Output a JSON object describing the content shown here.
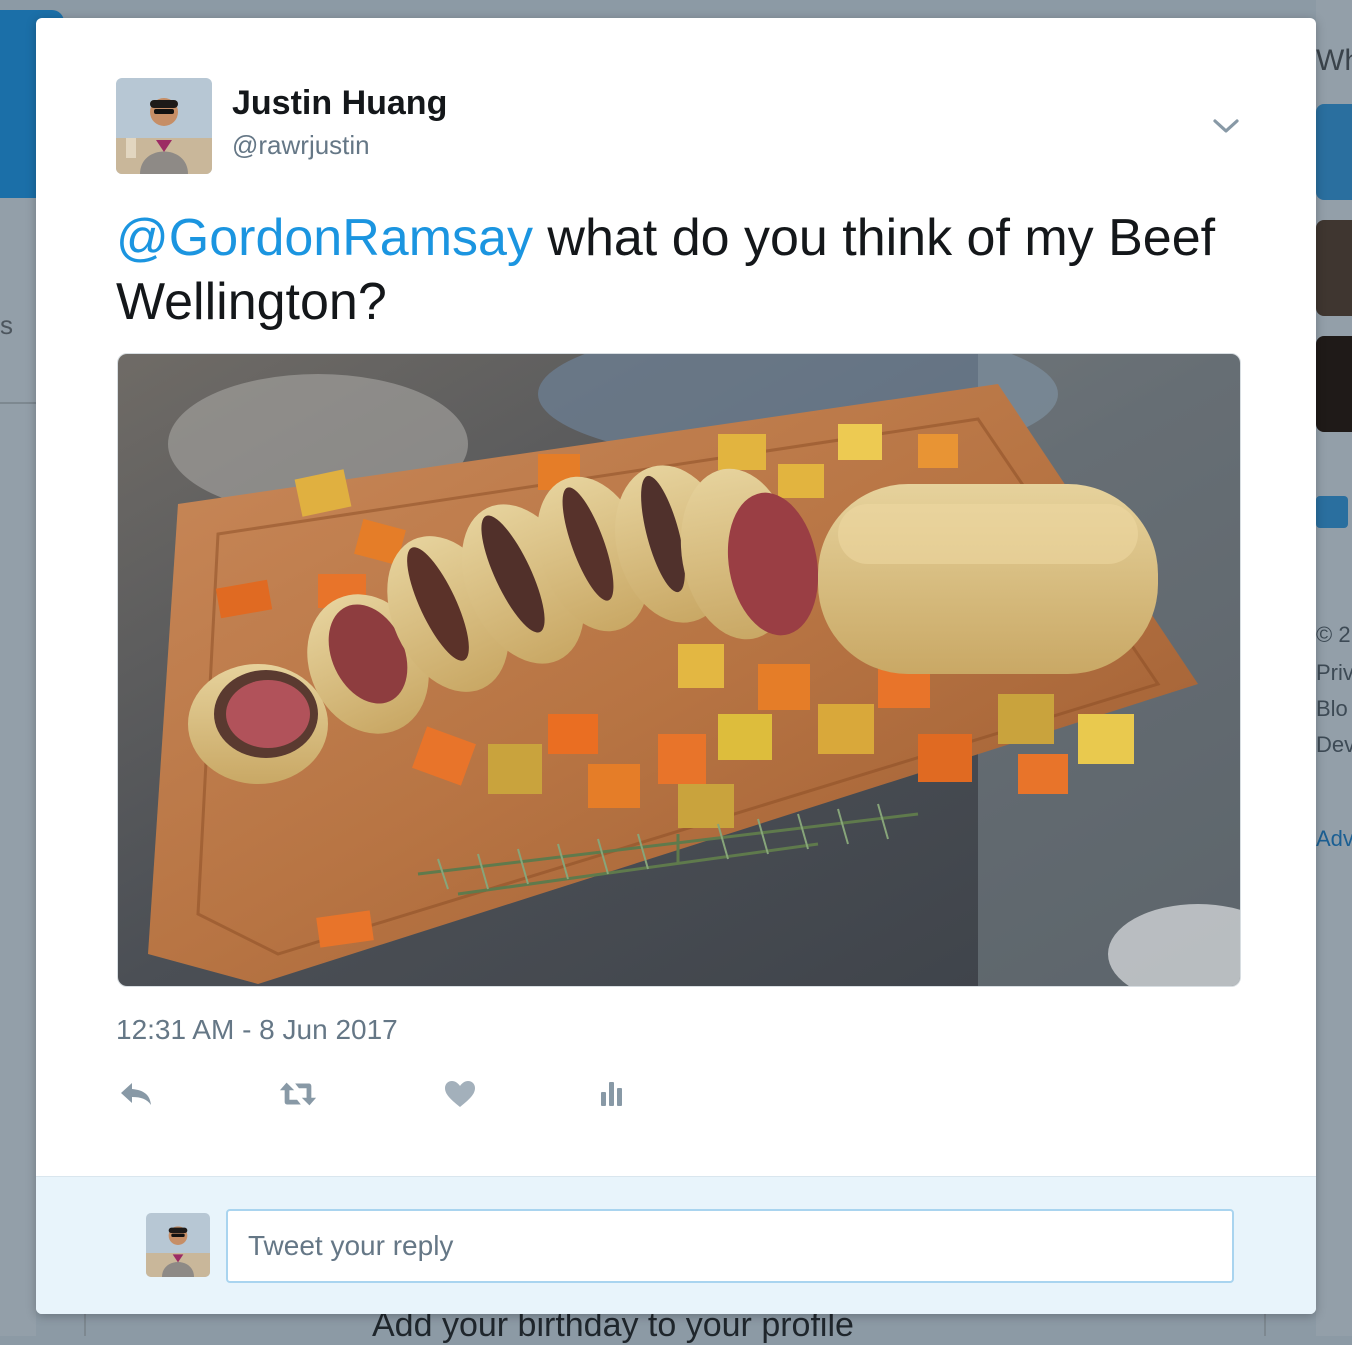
{
  "background": {
    "left_fragment": "s",
    "right_heading_fragment": "Wh",
    "right_footer_fragments": [
      "© 2",
      "Priv",
      "Blo",
      "Dev"
    ],
    "right_link_fragment": "Adv",
    "bottom_prompt": "Add your birthday to your profile"
  },
  "tweet": {
    "author_name": "Justin Huang",
    "author_handle": "@rawrjustin",
    "mention": "@GordonRamsay",
    "text": " what do you think of my Beef Wellington?",
    "timestamp": "12:31 AM - 8 Jun 2017",
    "photo_alt": "Beef Wellington sliced on a wooden cutting board with roasted carrots, potatoes and rosemary"
  },
  "actions": [
    {
      "name": "reply",
      "icon": "reply-icon"
    },
    {
      "name": "retweet",
      "icon": "retweet-icon"
    },
    {
      "name": "like",
      "icon": "heart-icon"
    },
    {
      "name": "analytics",
      "icon": "analytics-icon"
    }
  ],
  "reply_box": {
    "placeholder": "Tweet your reply"
  },
  "colors": {
    "link": "#1b95e0",
    "muted": "#657786",
    "text": "#14171a",
    "reply_bg": "#e8f4fb"
  }
}
